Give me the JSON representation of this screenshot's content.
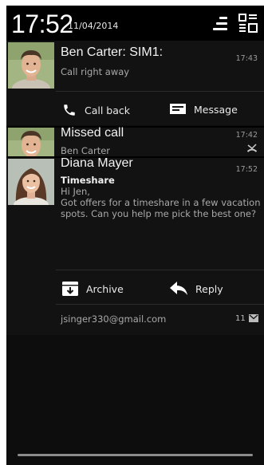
{
  "status": {
    "time": "17:52",
    "date": "11/04/2014"
  },
  "notifications": [
    {
      "title": "Ben Carter: SIM1:",
      "subtitle": "Call right away",
      "time": "17:43",
      "actions": [
        {
          "label": "Call back",
          "icon": "phone-icon"
        },
        {
          "label": "Message",
          "icon": "message-icon"
        }
      ]
    },
    {
      "title": "Missed call",
      "subtitle": "Ben Carter",
      "time": "17:42",
      "icon": "missed-call-icon"
    },
    {
      "title": "Diana Mayer",
      "subject": "Timeshare",
      "body_line1": "Hi Jen,",
      "body_line2": "Got offers for a timeshare in a few vacation",
      "body_line3": "spots. Can you help me pick the best one?",
      "time": "17:52",
      "actions": [
        {
          "label": "Archive",
          "icon": "archive-icon"
        },
        {
          "label": "Reply",
          "icon": "reply-icon"
        }
      ],
      "account": "jsinger330@gmail.com",
      "count": "11",
      "count_icon": "mail-icon"
    }
  ],
  "colors": {
    "background": "#0d0d0d",
    "header": "#000000",
    "primary_text": "#f2f2f2",
    "secondary_text": "#a9a9a9"
  }
}
